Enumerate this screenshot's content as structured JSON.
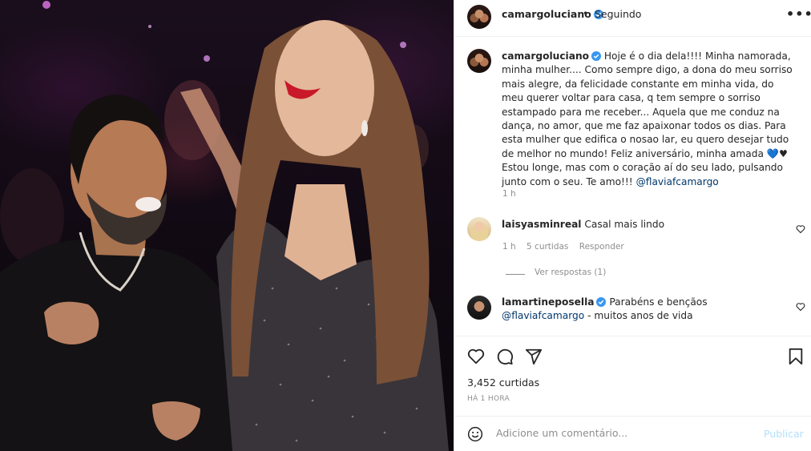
{
  "post": {
    "author": "camargoluciano",
    "follow_dot": "•",
    "follow_status": "Seguindo",
    "more_glyph": "•••"
  },
  "caption": {
    "author": "camargoluciano",
    "text": "Hoje é o dia dela!!!! Minha namorada, minha mulher.... Como sempre digo, a dona do meu sorriso mais alegre, da felicidade constante em minha vida, do meu querer voltar para casa, q tem sempre o sorriso estampado para me receber... Aquela que me conduz na dança, no amor, que me faz apaixonar todos os dias. Para esta mulher que edifica o nosao lar, eu quero desejar tudo de melhor no mundo! Feliz aniversário, minha amada 💙♥ Estou longe, mas com o coração aí do seu lado, pulsando junto com o seu. Te amo!!! ",
    "mention": "@flaviafcamargo",
    "time": "1 h"
  },
  "comments": [
    {
      "author": "laisyasminreal",
      "text": "Casal mais lindo",
      "time": "1 h",
      "likes": "5 curtidas",
      "reply_label": "Responder",
      "view_replies": "Ver respostas (1)"
    },
    {
      "author": "lamartineposella",
      "text_before": "Parabéns e bençãos ",
      "mention": "@flaviafcamargo",
      "text_after": " - muitos anos de vida"
    }
  ],
  "stats": {
    "likes": "3,452 curtidas",
    "posted": "HÁ 1 HORA"
  },
  "add_comment": {
    "placeholder": "Adicione um comentário...",
    "publish_label": "Publicar"
  },
  "icons": {
    "like": "heart-icon",
    "comment": "comment-icon",
    "share": "paper-plane-icon",
    "save": "bookmark-icon",
    "emoji": "emoji-icon",
    "verified": "verified-badge-icon"
  },
  "colors": {
    "link": "#00376b",
    "verified": "#3897f0",
    "muted": "#8e8e8e",
    "publish_disabled": "#b2dffc"
  }
}
